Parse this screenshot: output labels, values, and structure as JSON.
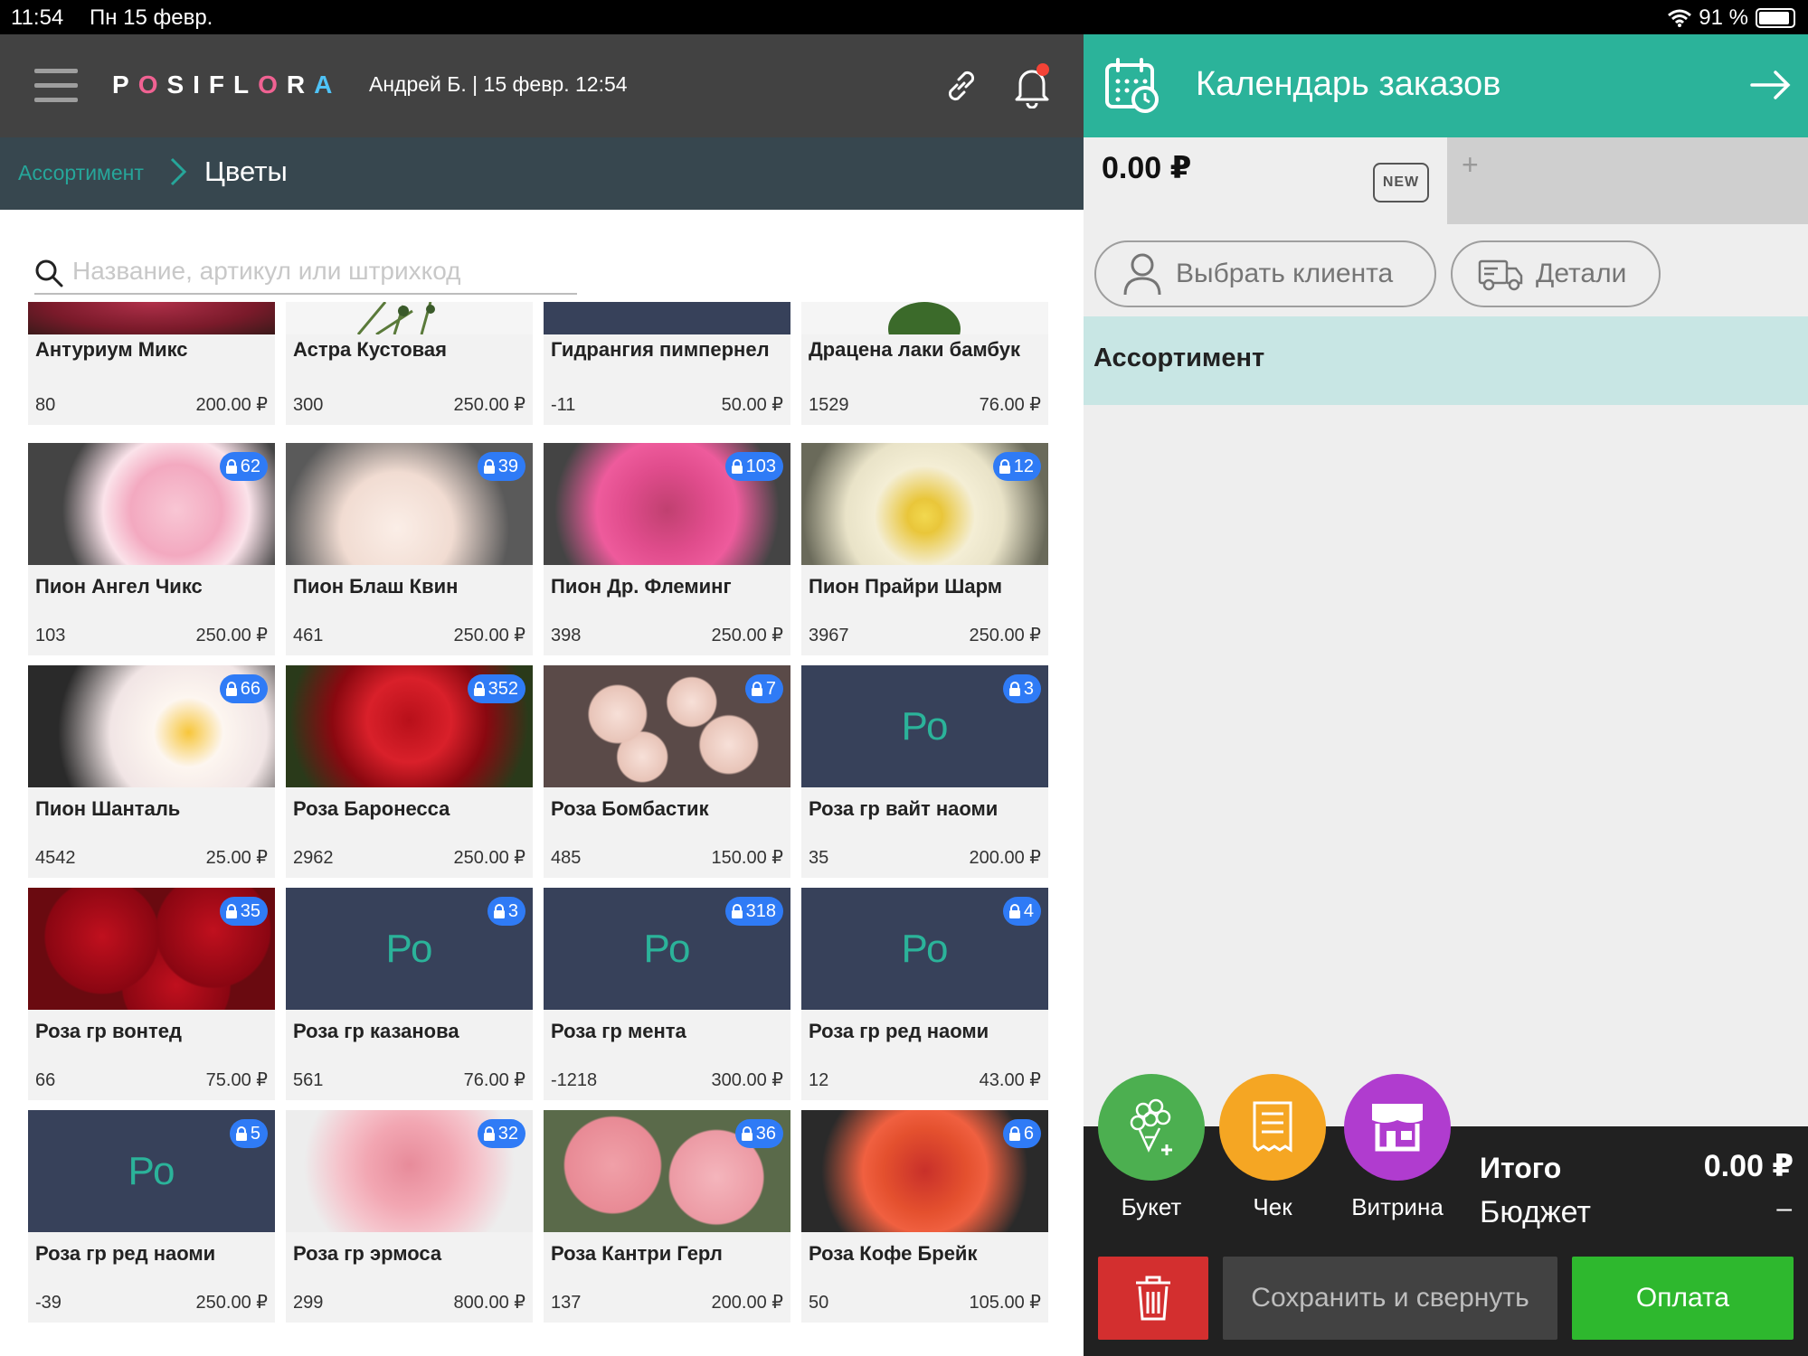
{
  "status_bar": {
    "time": "11:54",
    "date": "Пн 15 февр.",
    "battery": "91 %"
  },
  "header": {
    "logo": "POSIFLORA",
    "user_info": "Андрей Б.  | 15 февр. 12:54"
  },
  "breadcrumb": {
    "parent": "Ассортимент",
    "current": "Цветы"
  },
  "search": {
    "placeholder": "Название, артикул или штрихкод"
  },
  "products": [
    {
      "name": "Антуриум Микс",
      "qty": "80",
      "price": "200.00 ₽",
      "badge": "",
      "image": "anthurium",
      "partial": true
    },
    {
      "name": "Астра Кустовая",
      "qty": "300",
      "price": "250.00 ₽",
      "badge": "",
      "image": "aster",
      "partial": true
    },
    {
      "name": "Гидрангия пимпернел",
      "qty": "-11",
      "price": "50.00 ₽",
      "badge": "",
      "image": "placeholder",
      "partial": true
    },
    {
      "name": "Драцена лаки бамбук",
      "qty": "1529",
      "price": "76.00 ₽",
      "badge": "",
      "image": "dracena",
      "partial": true
    },
    {
      "name": "Пион Ангел Чикс",
      "qty": "103",
      "price": "250.00 ₽",
      "badge": "62",
      "image": "peony-pink"
    },
    {
      "name": "Пион Блаш Квин",
      "qty": "461",
      "price": "250.00 ₽",
      "badge": "39",
      "image": "peony-white"
    },
    {
      "name": "Пион Др. Флеминг",
      "qty": "398",
      "price": "250.00 ₽",
      "badge": "103",
      "image": "peony-magenta"
    },
    {
      "name": "Пион Прайри Шарм",
      "qty": "3967",
      "price": "250.00 ₽",
      "badge": "12",
      "image": "peony-cream"
    },
    {
      "name": "Пион Шанталь",
      "qty": "4542",
      "price": "25.00 ₽",
      "badge": "66",
      "image": "peony-white2"
    },
    {
      "name": "Роза Баронесса",
      "qty": "2962",
      "price": "250.00 ₽",
      "badge": "352",
      "image": "rose-red"
    },
    {
      "name": "Роза Бомбастик",
      "qty": "485",
      "price": "150.00 ₽",
      "badge": "7",
      "image": "rose-spray"
    },
    {
      "name": "Роза гр вайт наоми",
      "qty": "35",
      "price": "200.00 ₽",
      "badge": "3",
      "image": "placeholder",
      "placeholder_text": "Ро"
    },
    {
      "name": "Роза гр вонтед",
      "qty": "66",
      "price": "75.00 ₽",
      "badge": "35",
      "image": "rose-darkred"
    },
    {
      "name": "Роза гр казанова",
      "qty": "561",
      "price": "76.00 ₽",
      "badge": "3",
      "image": "placeholder",
      "placeholder_text": "Ро"
    },
    {
      "name": "Роза гр мента",
      "qty": "-1218",
      "price": "300.00 ₽",
      "badge": "318",
      "image": "placeholder",
      "placeholder_text": "Ро"
    },
    {
      "name": "Роза гр ред наоми",
      "qty": "12",
      "price": "43.00 ₽",
      "badge": "4",
      "image": "placeholder",
      "placeholder_text": "Ро"
    },
    {
      "name": "Роза гр ред наоми",
      "qty": "-39",
      "price": "250.00 ₽",
      "badge": "5",
      "image": "placeholder",
      "placeholder_text": "Ро"
    },
    {
      "name": "Роза гр эрмоса",
      "qty": "299",
      "price": "800.00 ₽",
      "badge": "32",
      "image": "rose-lightpink"
    },
    {
      "name": "Роза Кантри Герл",
      "qty": "137",
      "price": "200.00 ₽",
      "badge": "36",
      "image": "rose-country"
    },
    {
      "name": "Роза Кофе Брейк",
      "qty": "50",
      "price": "105.00 ₽",
      "badge": "6",
      "image": "rose-orange"
    }
  ],
  "right_panel": {
    "title": "Календарь заказов",
    "order_amount": "0.00 ₽",
    "new_label": "NEW",
    "add_tab": "+",
    "choose_client": "Выбрать клиента",
    "details": "Детали",
    "section_title": "Ассортимент",
    "actions": {
      "bouquet": "Букет",
      "check": "Чек",
      "showcase": "Витрина"
    },
    "total_label": "Итого",
    "total_value": "0.00 ₽",
    "budget_label": "Бюджет",
    "budget_value": "–",
    "save_button": "Сохранить и свернуть",
    "pay_button": "Оплата"
  },
  "colors": {
    "accent": "#2bb39a",
    "header_dark": "#424242",
    "breadcrumb_bg": "#37474f",
    "badge_blue": "#2f7bf6",
    "pay_green": "#2eb82e",
    "delete_red": "#d32f2f"
  }
}
